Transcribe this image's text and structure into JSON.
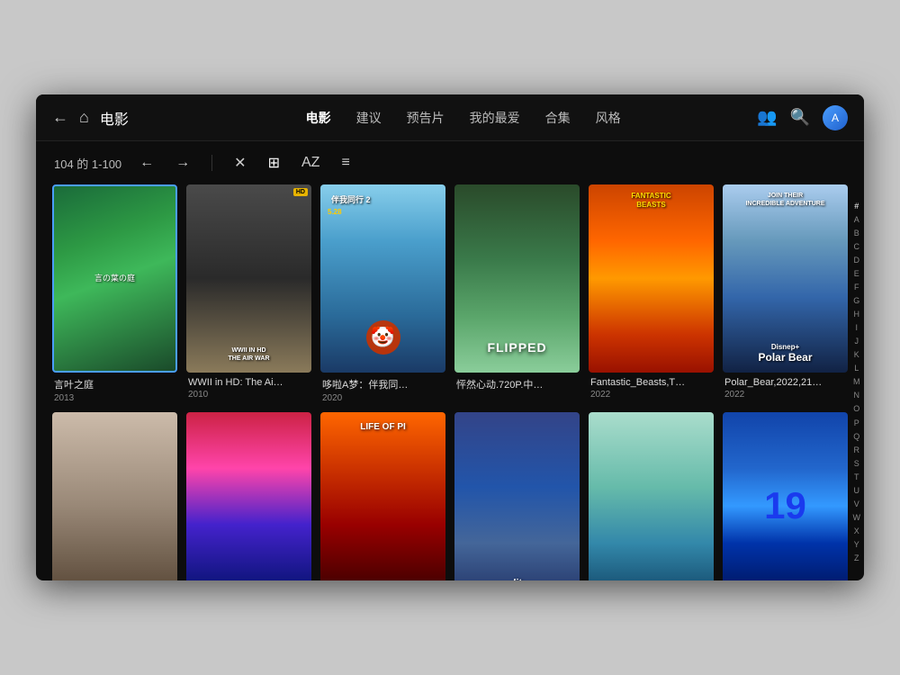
{
  "nav": {
    "back_icon": "←",
    "home_icon": "⌂",
    "title": "电影",
    "items": [
      {
        "label": "电影",
        "active": true
      },
      {
        "label": "建议",
        "active": false
      },
      {
        "label": "预告片",
        "active": false
      },
      {
        "label": "我的最爱",
        "active": false
      },
      {
        "label": "合集",
        "active": false
      },
      {
        "label": "风格",
        "active": false
      }
    ],
    "people_icon": "👥",
    "search_icon": "🔍",
    "avatar_label": "A"
  },
  "toolbar": {
    "pagination": "104 的 1-100",
    "prev_icon": "←",
    "next_icon": "→",
    "sort_icon": "✕",
    "grid_icon": "⊞",
    "az_icon": "AZ",
    "filter_icon": "≡"
  },
  "movies": [
    {
      "id": 1,
      "name": "言叶之庭",
      "year": "2013",
      "poster_class": "poster-1",
      "selected": true,
      "text": "言の葉の庭"
    },
    {
      "id": 2,
      "name": "WWII in HD: The Ai…",
      "year": "2010",
      "poster_class": "poster-2",
      "selected": false,
      "text": "WWII IN HD\nTHE AIR WAR"
    },
    {
      "id": 3,
      "name": "哆啦A梦：伴我同…",
      "year": "2020",
      "poster_class": "poster-3",
      "selected": false,
      "text": "伴我同行 2\n5.28"
    },
    {
      "id": 4,
      "name": "怦然心动.720P.中…",
      "year": "",
      "poster_class": "poster-4",
      "selected": false,
      "text": "FLIPPED"
    },
    {
      "id": 5,
      "name": "Fantastic_Beasts,T…",
      "year": "2022",
      "poster_class": "poster-5",
      "selected": false,
      "text": "FANTASTIC\nBEASTS"
    },
    {
      "id": 6,
      "name": "Polar_Bear,2022,21…",
      "year": "2022",
      "poster_class": "poster-6",
      "selected": false,
      "text": "POLAR BEAR"
    },
    {
      "id": 7,
      "name": "",
      "year": "",
      "poster_class": "poster-7",
      "selected": false,
      "text": ""
    },
    {
      "id": 8,
      "name": "",
      "year": "",
      "poster_class": "poster-8",
      "selected": false,
      "text": ""
    },
    {
      "id": 9,
      "name": "LIFE OF PI",
      "year": "",
      "poster_class": "poster-9",
      "selected": false,
      "text": "LIFE OF PI"
    },
    {
      "id": 10,
      "name": "",
      "year": "",
      "poster_class": "poster-10",
      "selected": false,
      "text": "lit"
    },
    {
      "id": 11,
      "name": "",
      "year": "",
      "poster_class": "poster-11",
      "selected": false,
      "text": ""
    },
    {
      "id": 12,
      "name": "",
      "year": "",
      "poster_class": "poster-12",
      "selected": false,
      "text": "19"
    }
  ],
  "alphabet": [
    "#",
    "A",
    "B",
    "C",
    "D",
    "E",
    "F",
    "G",
    "H",
    "I",
    "J",
    "K",
    "L",
    "M",
    "N",
    "O",
    "P",
    "Q",
    "R",
    "S",
    "T",
    "U",
    "V",
    "W",
    "X",
    "Y",
    "Z"
  ]
}
